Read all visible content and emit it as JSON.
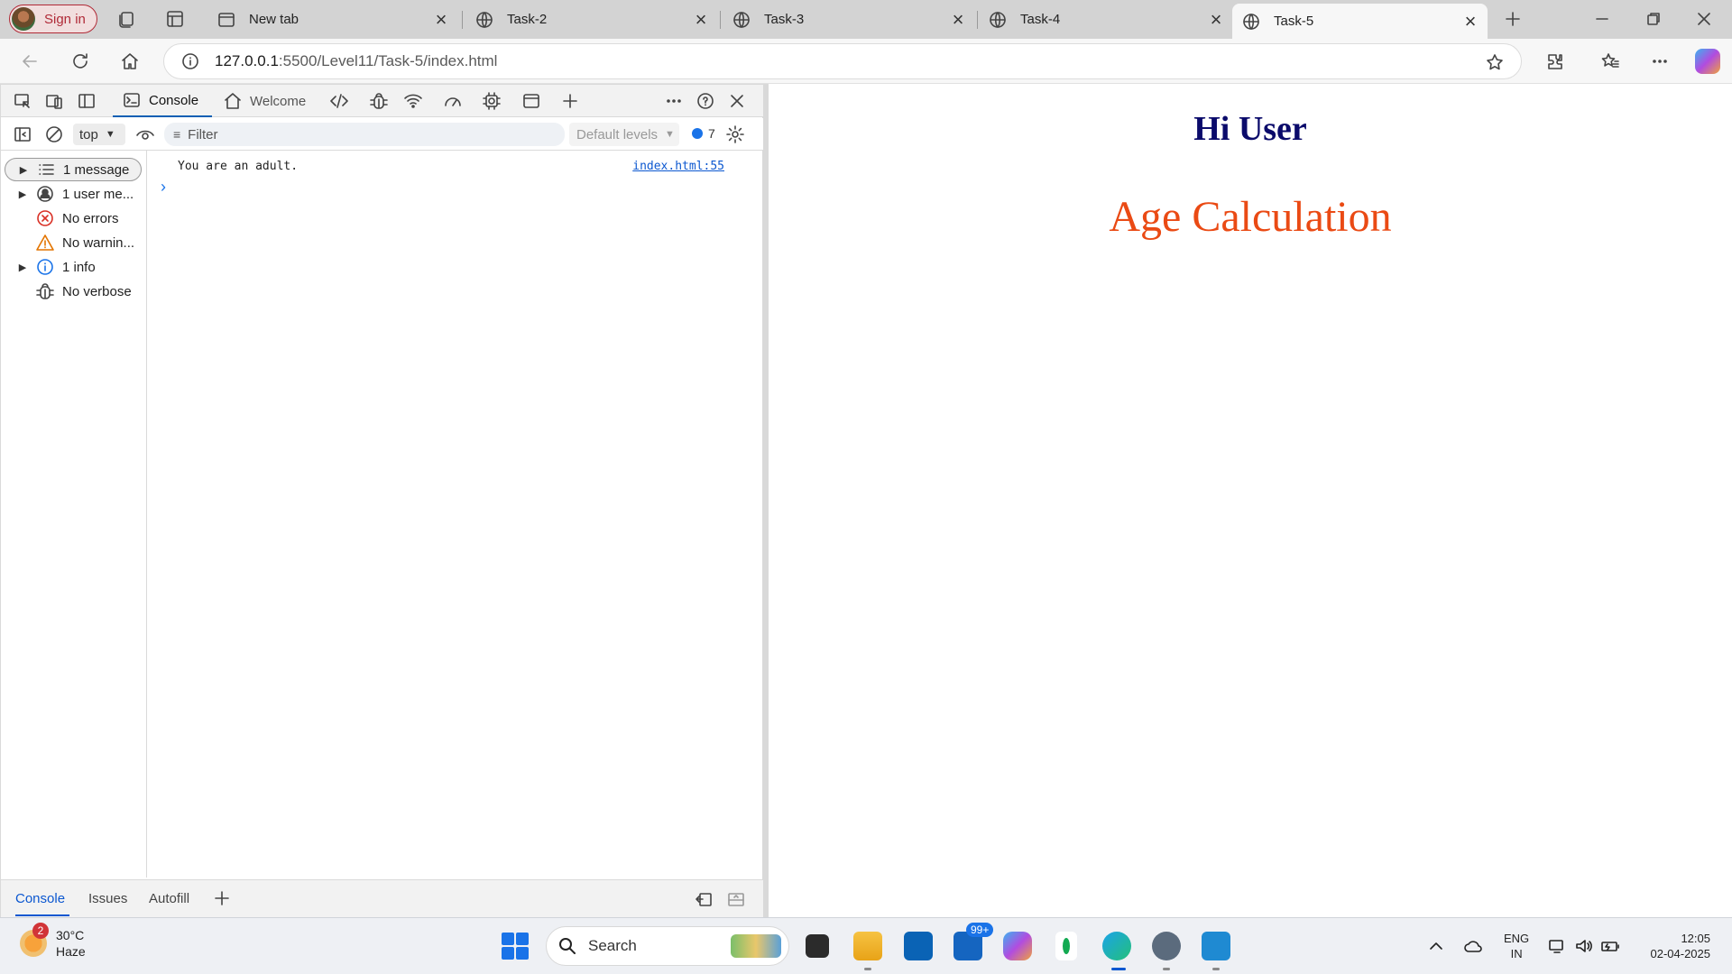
{
  "browser": {
    "sign_in_label": "Sign in",
    "tabs": [
      {
        "title": "New tab"
      },
      {
        "title": "Task-2"
      },
      {
        "title": "Task-3"
      },
      {
        "title": "Task-4"
      },
      {
        "title": "Task-5"
      }
    ],
    "url_host": "127.0.0.1",
    "url_rest": ":5500/Level11/Task-5/index.html"
  },
  "devtools": {
    "tabs": {
      "console": "Console",
      "welcome": "Welcome"
    },
    "context": "top",
    "filter_placeholder": "Filter",
    "levels": "Default levels",
    "issues_count": "7",
    "sidebar": [
      {
        "label": "1 message"
      },
      {
        "label": "1 user me..."
      },
      {
        "label": "No errors"
      },
      {
        "label": "No warnin..."
      },
      {
        "label": "1 info"
      },
      {
        "label": "No verbose"
      }
    ],
    "log": {
      "message": "You are an adult.",
      "source": "index.html:55"
    },
    "prompt": "›",
    "drawer": {
      "console": "Console",
      "issues": "Issues",
      "autofill": "Autofill"
    }
  },
  "page": {
    "heading": "Hi User",
    "subheading": "Age Calculation"
  },
  "taskbar": {
    "weather": {
      "temp": "30°C",
      "condition": "Haze",
      "badge": "2"
    },
    "search_label": "Search",
    "mail_badge": "99+",
    "lang": {
      "line1": "ENG",
      "line2": "IN"
    },
    "clock": {
      "time": "12:05",
      "date": "02-04-2025"
    }
  }
}
